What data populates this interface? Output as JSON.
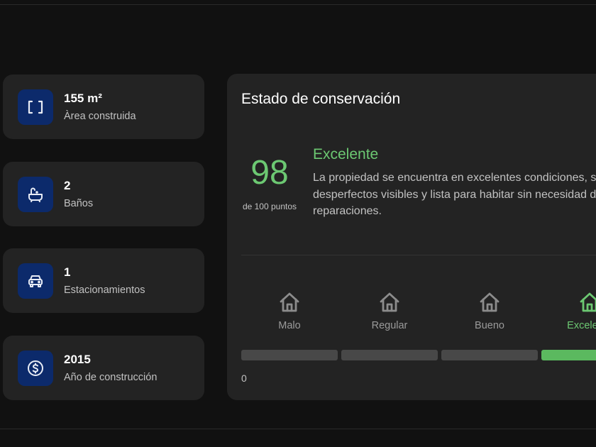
{
  "stats": [
    {
      "value": "155 m²",
      "label": "Àrea construida",
      "icon": "area-bracket-icon"
    },
    {
      "value": "2",
      "label": "Baños",
      "icon": "bathtub-icon"
    },
    {
      "value": "1",
      "label": "Estacionamientos",
      "icon": "car-icon"
    },
    {
      "value": "2015",
      "label": "Año de construcción",
      "icon": "dollar-coin-icon"
    }
  ],
  "conservation": {
    "title": "Estado de conservación",
    "score": "98",
    "score_sub": "de 100 puntos",
    "rating": "Excelente",
    "description": "La propiedad se encuentra en excelentes condiciones, sin desperfectos visibles y lista para habitar sin necesidad de reparaciones.",
    "levels": [
      {
        "label": "Malo",
        "icon": "house-icon"
      },
      {
        "label": "Regular",
        "icon": "house-icon"
      },
      {
        "label": "Bueno",
        "icon": "house-icon"
      },
      {
        "label": "Excelente",
        "icon": "house-icon",
        "active": true
      }
    ],
    "scale_min": "0",
    "score_value": 98
  },
  "colors": {
    "accent_green": "#6cc872",
    "icon_bg": "#0c2a6b",
    "card_bg": "#232323",
    "page_bg": "#111111"
  }
}
